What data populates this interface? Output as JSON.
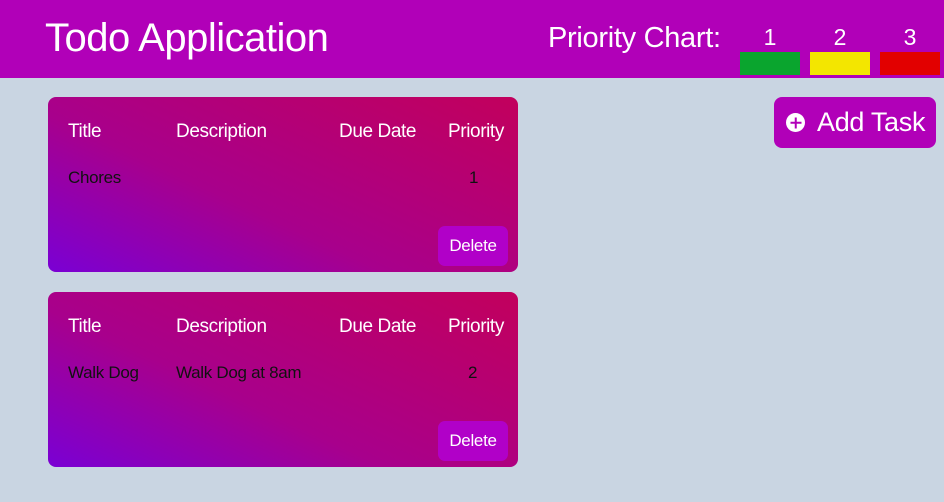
{
  "header": {
    "title": "Todo Application",
    "chart_label": "Priority Chart:",
    "chart_items": [
      {
        "label": "1",
        "color": "#0aa52e"
      },
      {
        "label": "2",
        "color": "#f3e600"
      },
      {
        "label": "3",
        "color": "#e20000"
      }
    ]
  },
  "add_task": {
    "label": "Add Task"
  },
  "columns": [
    "Title",
    "Description",
    "Due Date",
    "Priority"
  ],
  "tasks": [
    {
      "title": "Chores",
      "description": "",
      "due_date": "",
      "priority": "1",
      "delete_label": "Delete"
    },
    {
      "title": "Walk Dog",
      "description": "Walk Dog at 8am",
      "due_date": "",
      "priority": "2",
      "delete_label": "Delete"
    }
  ],
  "colors": {
    "header_bg": "#b100b8",
    "page_bg": "#c9d5e2",
    "button_bg": "#b100b8"
  }
}
